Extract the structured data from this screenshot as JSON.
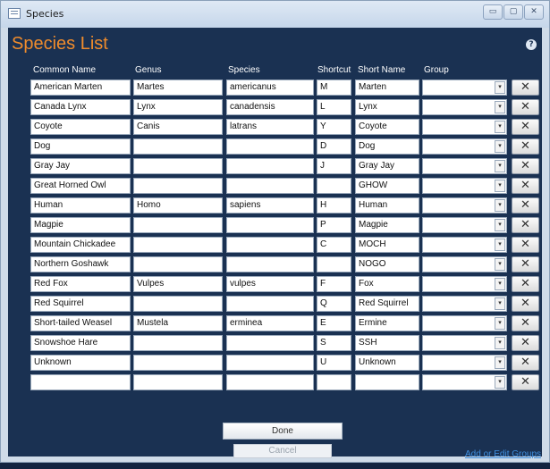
{
  "window": {
    "title": "Species",
    "controls": [
      "▭",
      "▢",
      "✕"
    ]
  },
  "form": {
    "title": "Species List",
    "help_icon": "?"
  },
  "columns": [
    "Common Name",
    "Genus",
    "Species",
    "Shortcut",
    "Short Name",
    "Group"
  ],
  "rows": [
    {
      "common": "American Marten",
      "genus": "Martes",
      "species": "americanus",
      "shortcut": "M",
      "short_name": "Marten",
      "group": ""
    },
    {
      "common": "Canada Lynx",
      "genus": "Lynx",
      "species": "canadensis",
      "shortcut": "L",
      "short_name": "Lynx",
      "group": ""
    },
    {
      "common": "Coyote",
      "genus": "Canis",
      "species": "latrans",
      "shortcut": "Y",
      "short_name": "Coyote",
      "group": ""
    },
    {
      "common": "Dog",
      "genus": "",
      "species": "",
      "shortcut": "D",
      "short_name": "Dog",
      "group": ""
    },
    {
      "common": "Gray Jay",
      "genus": "",
      "species": "",
      "shortcut": "J",
      "short_name": "Gray Jay",
      "group": ""
    },
    {
      "common": "Great Horned Owl",
      "genus": "",
      "species": "",
      "shortcut": "",
      "short_name": "GHOW",
      "group": ""
    },
    {
      "common": "Human",
      "genus": "Homo",
      "species": "sapiens",
      "shortcut": "H",
      "short_name": "Human",
      "group": ""
    },
    {
      "common": "Magpie",
      "genus": "",
      "species": "",
      "shortcut": "P",
      "short_name": "Magpie",
      "group": ""
    },
    {
      "common": "Mountain Chickadee",
      "genus": "",
      "species": "",
      "shortcut": "C",
      "short_name": "MOCH",
      "group": ""
    },
    {
      "common": "Northern Goshawk",
      "genus": "",
      "species": "",
      "shortcut": "",
      "short_name": "NOGO",
      "group": ""
    },
    {
      "common": "Red Fox",
      "genus": "Vulpes",
      "species": "vulpes",
      "shortcut": "F",
      "short_name": "Fox",
      "group": ""
    },
    {
      "common": "Red Squirrel",
      "genus": "",
      "species": "",
      "shortcut": "Q",
      "short_name": "Red Squirrel",
      "group": ""
    },
    {
      "common": "Short-tailed Weasel",
      "genus": "Mustela",
      "species": "erminea",
      "shortcut": "E",
      "short_name": "Ermine",
      "group": ""
    },
    {
      "common": "Snowshoe Hare",
      "genus": "",
      "species": "",
      "shortcut": "S",
      "short_name": "SSH",
      "group": ""
    },
    {
      "common": "Unknown",
      "genus": "",
      "species": "",
      "shortcut": "U",
      "short_name": "Unknown",
      "group": ""
    },
    {
      "common": "",
      "genus": "",
      "species": "",
      "shortcut": "",
      "short_name": "",
      "group": ""
    }
  ],
  "icons": {
    "dropdown": "▾",
    "delete": "✕"
  },
  "buttons": {
    "done": "Done",
    "cancel": "Cancel"
  },
  "links": {
    "groups": "Add or Edit Groups"
  },
  "colors": {
    "title": "#f08c2c",
    "form_bg": "#1a3152",
    "link": "#3f8fe0"
  }
}
